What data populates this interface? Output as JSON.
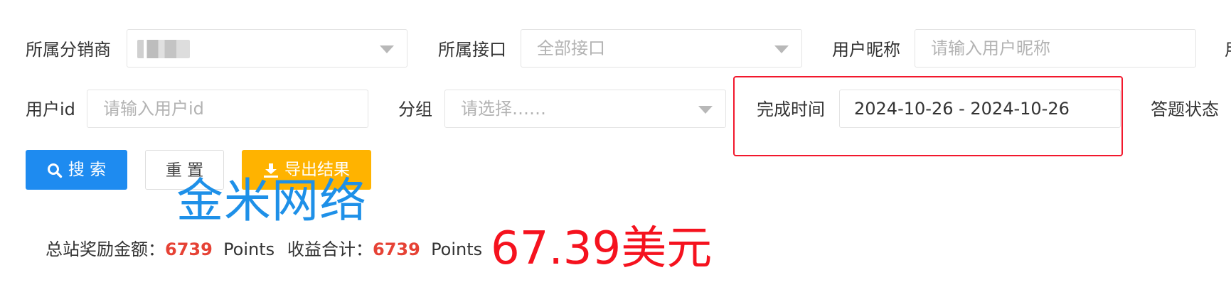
{
  "filters": {
    "distributor": {
      "label": "所属分销商"
    },
    "interface": {
      "label": "所属接口",
      "value": "全部接口"
    },
    "nickname": {
      "label": "用户昵称",
      "placeholder": "请输入用户昵称"
    },
    "row1_cutoff_label": "用",
    "user_id": {
      "label": "用户id",
      "placeholder": "请输入用户id"
    },
    "group": {
      "label": "分组",
      "placeholder": "请选择……"
    },
    "finish_time": {
      "label": "完成时间",
      "value": "2024-10-26 - 2024-10-26"
    },
    "answer_status": {
      "label": "答题状态"
    }
  },
  "actions": {
    "search_label": "搜 索",
    "reset_label": "重 置",
    "export_label": "导出结果"
  },
  "watermark": "金米网络",
  "summary": {
    "total_reward_label": "总站奖励金额：",
    "total_reward_value": "6739",
    "total_reward_unit": "Points",
    "income_label": "收益合计：",
    "income_value": "6739",
    "income_unit": "Points",
    "usd_amount": "67.39美元"
  },
  "colors": {
    "primary": "#1e8bf0",
    "warning": "#ffb300",
    "highlight_border": "#f2182d",
    "amount_red": "#f5121e",
    "number_red": "#e64235",
    "watermark": "#1e90e8"
  }
}
